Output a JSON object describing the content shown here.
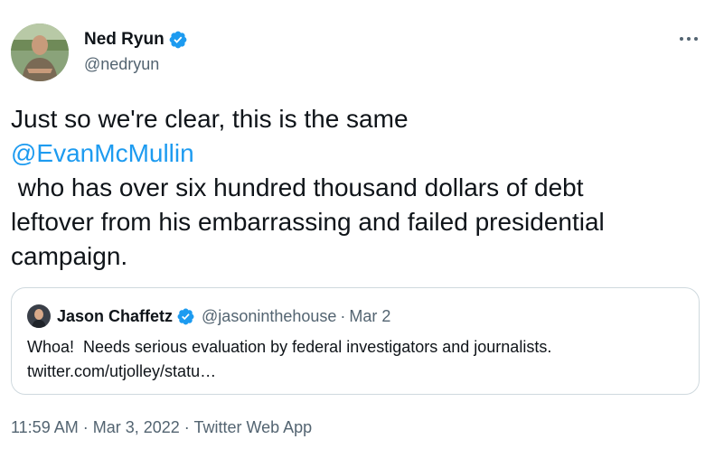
{
  "author": {
    "name": "Ned Ryun",
    "handle": "@nedryun",
    "verified": true,
    "avatar_icon": "profile-photo"
  },
  "more_icon": "more-horizontal-icon",
  "tweet": {
    "line1": "Just so we're clear, this is the same",
    "mention": "@EvanMcMullin",
    "line3": " who has over six hundred thousand dollars of debt",
    "line4": "leftover from his embarrassing and failed presidential",
    "line5": "campaign."
  },
  "quoted_tweet": {
    "name": "Jason Chaffetz",
    "handle": "@jasoninthehouse",
    "separator": "·",
    "date": "Mar 2",
    "text_line1": "Whoa!  Needs serious evaluation by federal investigators and journalists.",
    "text_line2": "twitter.com/utjolley/statu…"
  },
  "meta": {
    "time": "11:59 AM",
    "sep1": " · ",
    "date": "Mar 3, 2022",
    "sep2": " · ",
    "source": "Twitter Web App"
  },
  "colors": {
    "accent": "#1d9bf0",
    "secondary_text": "#536471",
    "border": "#cfd9de"
  }
}
